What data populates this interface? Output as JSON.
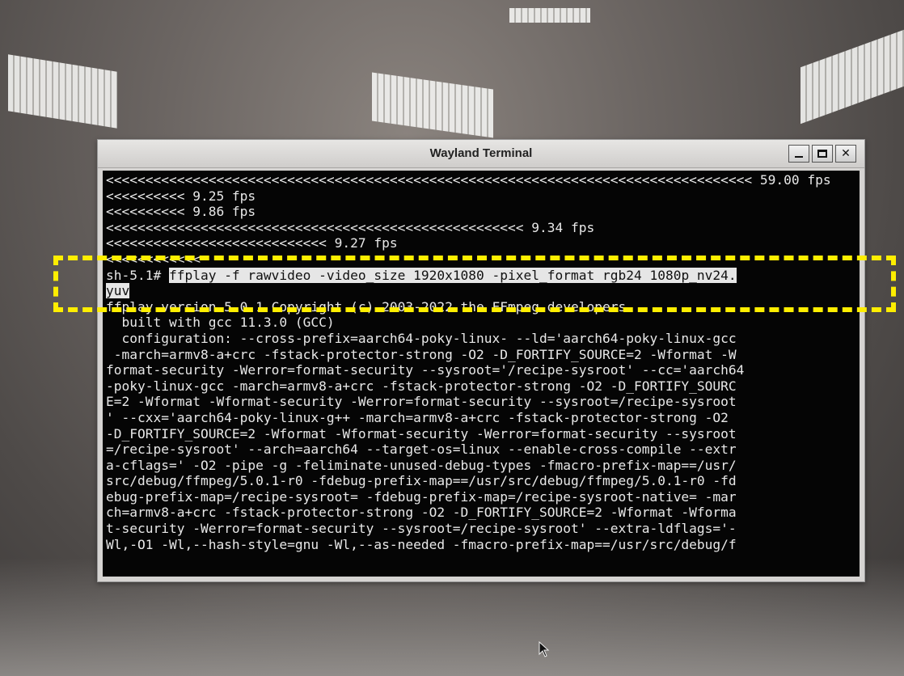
{
  "window": {
    "title": "Wayland Terminal",
    "controls": {
      "minimize": "_",
      "close": "✕"
    }
  },
  "terminal": {
    "lines": [
      "<<<<<<<<<<<<<<<<<<<<<<<<<<<<<<<<<<<<<<<<<<<<<<<<<<<<<<<<<<<<<<<<<<<<<<<<<<<<<<<<<< 59.00 fps",
      "<<<<<<<<<< 9.25 fps",
      "<<<<<<<<<< 9.86 fps",
      "<<<<<<<<<<<<<<<<<<<<<<<<<<<<<<<<<<<<<<<<<<<<<<<<<<<<< 9.34 fps",
      "<<<<<<<<<<<<<<<<<<<<<<<<<<<< 9.27 fps",
      "<<<<<<<<<<<<",
      null,
      null,
      "ffplay version 5.0.1 Copyright (c) 2003-2022 the FFmpeg developers",
      "  built with gcc 11.3.0 (GCC)",
      "  configuration: --cross-prefix=aarch64-poky-linux- --ld='aarch64-poky-linux-gcc",
      " -march=armv8-a+crc -fstack-protector-strong -O2 -D_FORTIFY_SOURCE=2 -Wformat -W",
      "format-security -Werror=format-security --sysroot='/recipe-sysroot' --cc='aarch64",
      "-poky-linux-gcc -march=armv8-a+crc -fstack-protector-strong -O2 -D_FORTIFY_SOURC",
      "E=2 -Wformat -Wformat-security -Werror=format-security --sysroot=/recipe-sysroot",
      "' --cxx='aarch64-poky-linux-g++ -march=armv8-a+crc -fstack-protector-strong -O2",
      "-D_FORTIFY_SOURCE=2 -Wformat -Wformat-security -Werror=format-security --sysroot",
      "=/recipe-sysroot' --arch=aarch64 --target-os=linux --enable-cross-compile --extr",
      "a-cflags=' -O2 -pipe -g -feliminate-unused-debug-types -fmacro-prefix-map==/usr/",
      "src/debug/ffmpeg/5.0.1-r0 -fdebug-prefix-map==/usr/src/debug/ffmpeg/5.0.1-r0 -fd",
      "ebug-prefix-map=/recipe-sysroot= -fdebug-prefix-map=/recipe-sysroot-native= -mar",
      "ch=armv8-a+crc -fstack-protector-strong -O2 -D_FORTIFY_SOURCE=2 -Wformat -Wforma",
      "t-security -Werror=format-security --sysroot=/recipe-sysroot' --extra-ldflags='-",
      "Wl,-O1 -Wl,--hash-style=gnu -Wl,--as-needed -fmacro-prefix-map==/usr/src/debug/f"
    ],
    "prompt": "sh-5.1# ",
    "command_line_1": "ffplay -f rawvideo -video_size 1920x1080 -pixel_format rgb24 1080p_nv24.",
    "command_line_2": "yuv"
  },
  "colors": {
    "highlight_box": "#ffee00",
    "terminal_bg": "#050505",
    "terminal_fg": "#e8e8e8"
  }
}
